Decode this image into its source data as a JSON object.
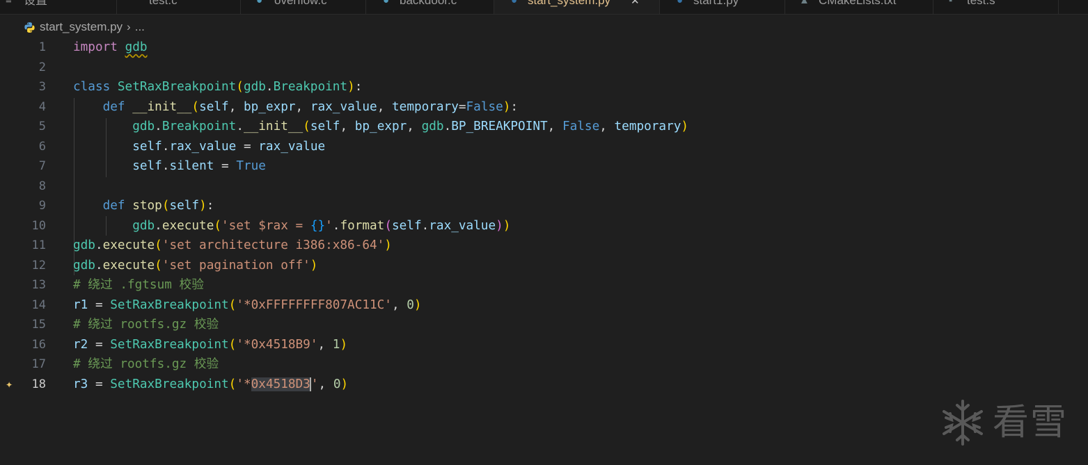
{
  "tabs": [
    {
      "label": "设置",
      "icon": "settings-icon",
      "active": false
    },
    {
      "label": "test.c",
      "icon": "c-file-icon",
      "active": false
    },
    {
      "label": "overflow.c",
      "icon": "c-file-icon",
      "active": false
    },
    {
      "label": "backdoor.c",
      "icon": "c-file-icon",
      "active": false
    },
    {
      "label": "start_system.py",
      "icon": "python-file-icon",
      "active": true
    },
    {
      "label": "start1.py",
      "icon": "python-file-icon",
      "active": false
    },
    {
      "label": "CMakeLists.txt",
      "icon": "cmake-file-icon",
      "active": false
    },
    {
      "label": "test.s",
      "icon": "asm-file-icon",
      "active": false
    }
  ],
  "breadcrumb": {
    "file": "start_system.py",
    "separator": "›",
    "ellipsis": "..."
  },
  "editor": {
    "current_line": 18,
    "selection_text": "0x4518D3",
    "lines": [
      {
        "n": "1",
        "code": "import gdb"
      },
      {
        "n": "2",
        "code": ""
      },
      {
        "n": "3",
        "code": "class SetRaxBreakpoint(gdb.Breakpoint):"
      },
      {
        "n": "4",
        "code": "    def __init__(self, bp_expr, rax_value, temporary=False):"
      },
      {
        "n": "5",
        "code": "        gdb.Breakpoint.__init__(self, bp_expr, gdb.BP_BREAKPOINT, False, temporary)"
      },
      {
        "n": "6",
        "code": "        self.rax_value = rax_value"
      },
      {
        "n": "7",
        "code": "        self.silent = True"
      },
      {
        "n": "8",
        "code": ""
      },
      {
        "n": "9",
        "code": "    def stop(self):"
      },
      {
        "n": "10",
        "code": "        gdb.execute('set $rax = {}'.format(self.rax_value))"
      },
      {
        "n": "11",
        "code": "gdb.execute('set architecture i386:x86-64')"
      },
      {
        "n": "12",
        "code": "gdb.execute('set pagination off')"
      },
      {
        "n": "13",
        "code": "# 绕过 .fgtsum 校验"
      },
      {
        "n": "14",
        "code": "r1 = SetRaxBreakpoint('*0xFFFFFFFF807AC11C', 0)"
      },
      {
        "n": "15",
        "code": "# 绕过 rootfs.gz 校验"
      },
      {
        "n": "16",
        "code": "r2 = SetRaxBreakpoint('*0x4518B9', 1)"
      },
      {
        "n": "17",
        "code": "# 绕过 rootfs.gz 校验"
      },
      {
        "n": "18",
        "code": "r3 = SetRaxBreakpoint('*0x4518D3', 0)"
      }
    ]
  },
  "watermark": {
    "text": "看雪",
    "icon": "snowflake-logo-icon"
  },
  "colors": {
    "background": "#1f1f1f",
    "keyword": "#569cd6",
    "class": "#4ec9b0",
    "function": "#dcdcaa",
    "variable": "#9cdcfe",
    "string": "#ce9178",
    "number": "#b5cea8",
    "comment": "#6a9955",
    "active_tab": "#e2c08d"
  }
}
